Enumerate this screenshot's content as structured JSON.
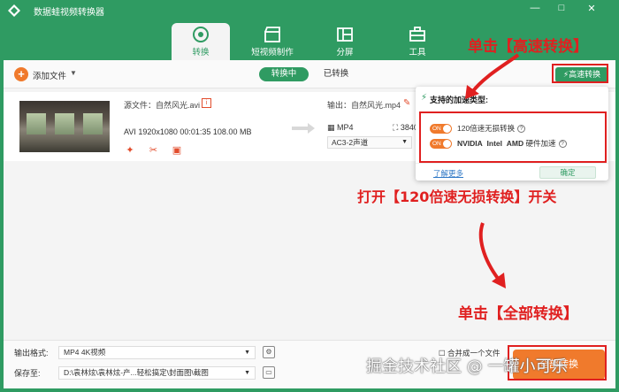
{
  "app": {
    "title": "数据蛙视频转换器",
    "window_controls": [
      "—",
      "□",
      "✕"
    ]
  },
  "tabs": [
    {
      "label": "转换",
      "active": true
    },
    {
      "label": "短视频制作",
      "active": false
    },
    {
      "label": "分屏",
      "active": false
    },
    {
      "label": "工具",
      "active": false
    }
  ],
  "toolbar": {
    "add_file_label": "添加文件",
    "segment_converting": "转换中",
    "segment_converted": "已转换",
    "fast_convert_label": "高速转换"
  },
  "file": {
    "source_label": "源文件：自然风光.avi",
    "meta": "AVI   1920x1080   00:01:35   108.00 MB",
    "output_label": "输出：自然风光.mp4",
    "output_format": "MP4",
    "output_resolution": "3840",
    "audio_track": "AC3-2声道"
  },
  "popup": {
    "heading": "支持的加速类型:",
    "toggle_state": "ON",
    "option1": "120倍速无损转换",
    "option2_nvidia": "NVIDIA",
    "option2_intel": "Intel",
    "option2_amd": "AMD",
    "option2_suffix": "硬件加速",
    "learn_more": "了解更多",
    "ok": "确定"
  },
  "bottom": {
    "output_format_label": "输出格式:",
    "output_format_value": "MP4 4K视频",
    "save_to_label": "保存至:",
    "save_to_value": "D:\\袁林炫\\袁林炫-产...轻松搞定\\封面图\\截图",
    "merge_label": "合并成一个文件",
    "convert_all_label": "全部转换"
  },
  "annotations": {
    "a1": "单击【高速转换】",
    "a2": "打开【120倍速无损转换】开关",
    "a3": "单击【全部转换】"
  },
  "watermark": "掘金技术社区 @ 一罐小可乐",
  "colors": {
    "brand": "#2f9b62",
    "accent": "#f07a2c",
    "annotation": "#e02020"
  }
}
